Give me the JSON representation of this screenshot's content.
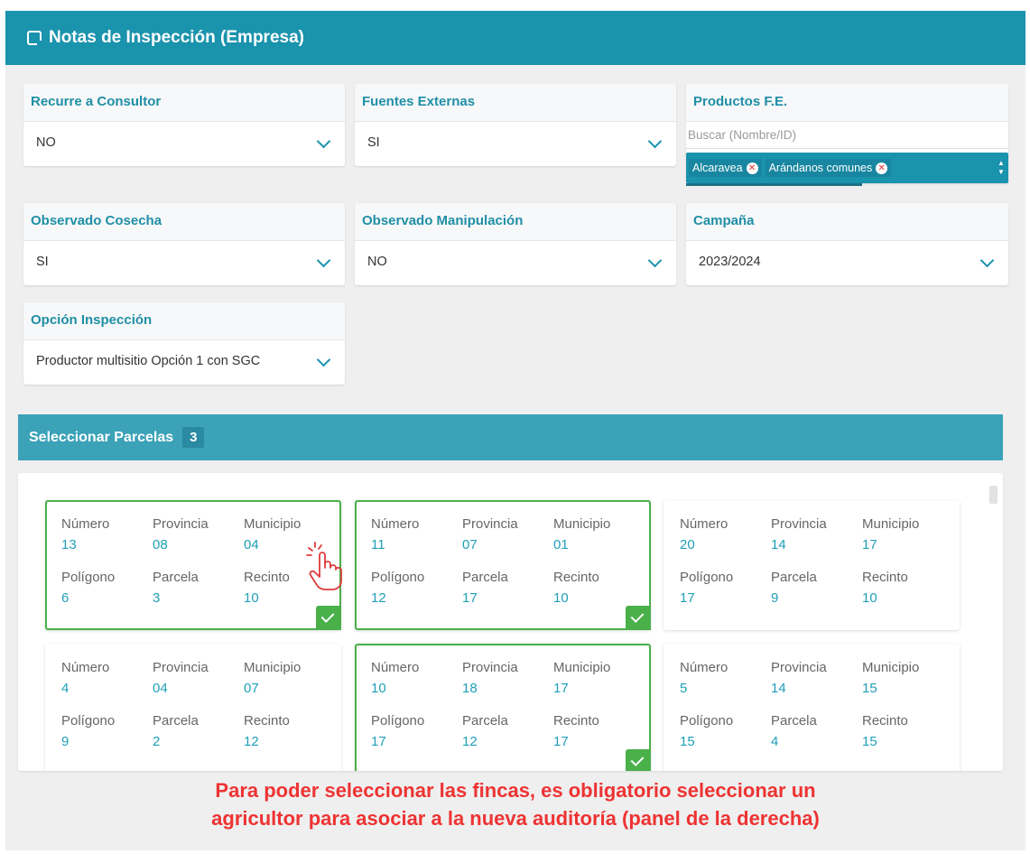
{
  "header": {
    "title": "Notas de Inspección (Empresa)"
  },
  "fields": {
    "recurre": {
      "label": "Recurre a Consultor",
      "value": "NO"
    },
    "fuentes": {
      "label": "Fuentes Externas",
      "value": "SI"
    },
    "productos": {
      "label": "Productos F.E.",
      "placeholder": "Buscar (Nombre/ID)",
      "tags": [
        "Alcaravea",
        "Arándanos comunes"
      ]
    },
    "cosecha": {
      "label": "Observado Cosecha",
      "value": "SI"
    },
    "manipulacion": {
      "label": "Observado Manipulación",
      "value": "NO"
    },
    "campana": {
      "label": "Campaña",
      "value": "2023/2024"
    },
    "opcion": {
      "label": "Opción Inspección",
      "value": "Productor multisitio Opción 1 con SGC"
    }
  },
  "parcelas": {
    "title": "Seleccionar Parcelas",
    "count": "3",
    "labels": {
      "numero": "Número",
      "provincia": "Provincia",
      "municipio": "Municipio",
      "poligono": "Polígono",
      "parcela": "Parcela",
      "recinto": "Recinto"
    },
    "cards": [
      {
        "numero": "13",
        "provincia": "08",
        "municipio": "04",
        "poligono": "6",
        "parcela": "3",
        "recinto": "10",
        "selected": true
      },
      {
        "numero": "11",
        "provincia": "07",
        "municipio": "01",
        "poligono": "12",
        "parcela": "17",
        "recinto": "10",
        "selected": true
      },
      {
        "numero": "20",
        "provincia": "14",
        "municipio": "17",
        "poligono": "17",
        "parcela": "9",
        "recinto": "10",
        "selected": false
      },
      {
        "numero": "4",
        "provincia": "04",
        "municipio": "07",
        "poligono": "9",
        "parcela": "2",
        "recinto": "12",
        "selected": false
      },
      {
        "numero": "10",
        "provincia": "18",
        "municipio": "17",
        "poligono": "17",
        "parcela": "12",
        "recinto": "17",
        "selected": true
      },
      {
        "numero": "5",
        "provincia": "14",
        "municipio": "15",
        "poligono": "15",
        "parcela": "4",
        "recinto": "15",
        "selected": false
      }
    ]
  },
  "note": {
    "line1": "Para poder seleccionar las fincas, es obligatorio seleccionar un",
    "line2": "agricultor para asociar a la nueva auditoría (panel de la derecha)"
  },
  "colors": {
    "accent": "#1a93ad",
    "selected": "#49b04a",
    "note": "#ee3333",
    "value": "#1f9fb6"
  },
  "icons": {
    "header": "note-icon",
    "dropdown": "chevron-down-icon",
    "remove": "remove-tag-icon",
    "selected": "check-icon",
    "pointer": "hand-pointer-icon"
  }
}
